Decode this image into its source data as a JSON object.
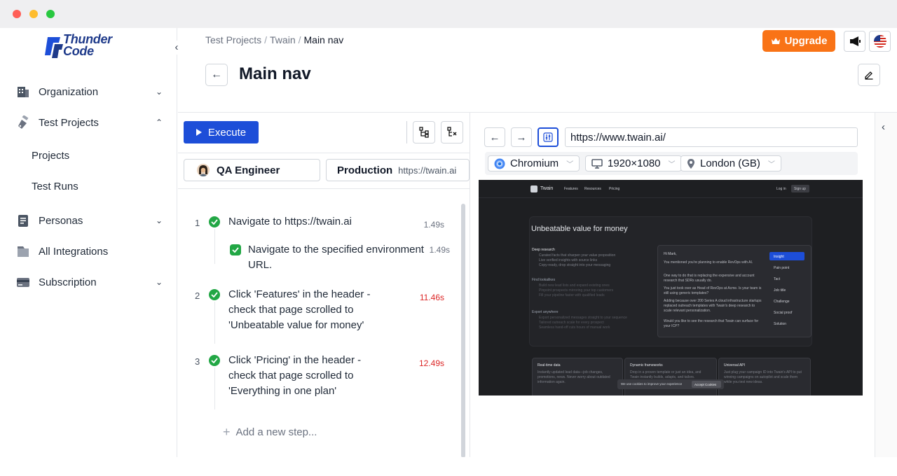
{
  "brand": {
    "logo_line1": "Thunder",
    "logo_line2": "Code"
  },
  "sidebar": {
    "items": [
      {
        "label": "Organization",
        "icon": "building-icon"
      },
      {
        "label": "Test Projects",
        "icon": "flask-icon"
      },
      {
        "label": "Projects"
      },
      {
        "label": "Test Runs"
      },
      {
        "label": "Personas",
        "icon": "document-icon"
      },
      {
        "label": "All Integrations",
        "icon": "folder-icon"
      },
      {
        "label": "Subscription",
        "icon": "card-icon"
      }
    ]
  },
  "header": {
    "breadcrumb": [
      "Test Projects",
      "Twain",
      "Main nav"
    ],
    "upgrade_label": "Upgrade",
    "title": "Main nav"
  },
  "toolbar": {
    "execute_label": "Execute"
  },
  "persona": {
    "name": "QA Engineer"
  },
  "environment": {
    "name": "Production",
    "url": "https://twain.ai"
  },
  "steps": [
    {
      "num": "1",
      "text": "Navigate to https://twain.ai",
      "time": "1.49s"
    },
    {
      "num": "",
      "text": "Navigate to the specified environment URL.",
      "time": "1.49s"
    },
    {
      "num": "2",
      "text": "Click 'Features' in the header - check that page scrolled to 'Unbeatable value for money'",
      "time": "11.46s"
    },
    {
      "num": "3",
      "text": "Click 'Pricing' in the header - check that page scrolled to 'Everything in one plan'",
      "time": "12.49s"
    }
  ],
  "add_step_label": "Add a new step...",
  "browser": {
    "url": "https://www.twain.ai/",
    "browser_name": "Chromium",
    "resolution": "1920×1080",
    "location": "London (GB)"
  },
  "preview": {
    "brand": "Twain",
    "nav": [
      "Features",
      "Resources",
      "Pricing"
    ],
    "login": "Log in",
    "signup": "Sign up",
    "heading": "Unbeatable value for money",
    "features": [
      {
        "title": "Deep research",
        "lines": [
          "Curated facts that sharpen your value proposition",
          "Live verified insights with source links",
          "Copy-ready, drop straight into your messaging"
        ]
      },
      {
        "title": "Find lookalikes",
        "lines": [
          "Build new lead lists and expand existing ones",
          "Pinpoint prospects mirroring your top customers",
          "Fill your pipeline faster with qualified leads"
        ]
      },
      {
        "title": "Export anywhere",
        "lines": [
          "Export personalized messages straight to your sequence",
          "Tailored outreach scale for every prospect",
          "Seamless hand-off cuts hours of manual work"
        ]
      }
    ],
    "chat": {
      "greeting": "Hi Mark,",
      "lines": [
        "You mentioned you're planning to enable RevOps with AI.",
        "One way to do that is replacing the expensive and account research that SDRs usually do.",
        "You just took over as Head of RevOps at Acme. Is your team is still using generic templates?",
        "Adding because over 200 Series A cloud infrastructure startups replaced outreach templates with Twain's deep research to scale relevant personalization.",
        "Would you like to see the research that Twain can surface for your ICP?"
      ]
    },
    "tags": [
      "Insight",
      "Pain point",
      "Tact",
      "Job title",
      "Challenge",
      "Social proof",
      "Solution"
    ],
    "cards": [
      {
        "title": "Real-time data",
        "text": "Instantly updated lead data—job changes, promotions, news. Never worry about outdated information again."
      },
      {
        "title": "Dynamic frameworks",
        "text": "Drop in a proven template or just an idea, and Twain instantly builds, adapts, and tailors."
      },
      {
        "title": "Universal API",
        "text": "Just plug your campaign ID into Twain's API to put winning campaigns on autopilot and scale them while you test new ideas."
      }
    ],
    "cookie_text": "We use cookies to improve your experience",
    "cookie_accept": "Accept Cookies"
  }
}
